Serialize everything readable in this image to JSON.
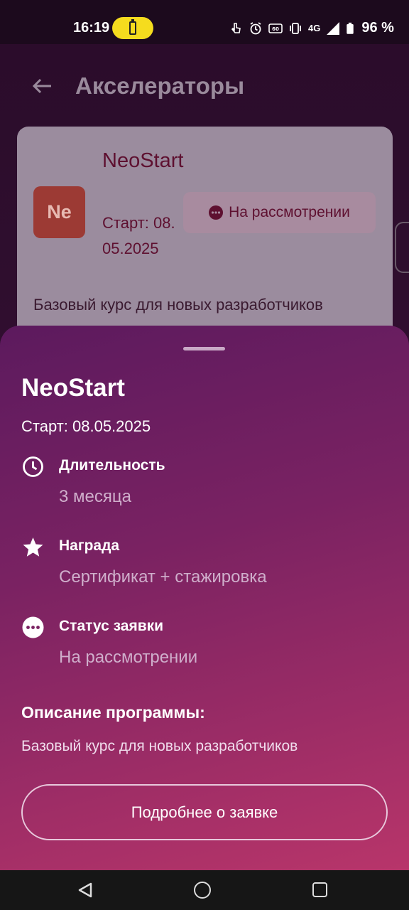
{
  "status_bar": {
    "time": "16:19",
    "battery_percent": "96 %",
    "network": "4G"
  },
  "app_bar": {
    "title": "Акселераторы"
  },
  "background_card": {
    "logo_text": "Ne",
    "name": "NeoStart",
    "start": "Старт: 08.05.2025",
    "status": "На рассмотрении",
    "description": "Базовый курс для новых разработчиков"
  },
  "sheet": {
    "title": "NeoStart",
    "start": "Старт: 08.05.2025",
    "details": [
      {
        "icon": "clock-icon",
        "label": "Длительность",
        "value": "3 месяца"
      },
      {
        "icon": "star-icon",
        "label": "Награда",
        "value": "Сертификат + стажировка"
      },
      {
        "icon": "more-dots-icon",
        "label": "Статус заявки",
        "value": "На рассмотрении"
      }
    ],
    "description_heading": "Описание программы:",
    "description": "Базовый курс для новых разработчиков",
    "button_label": "Подробнее о заявке"
  },
  "colors": {
    "sheet_gradient_start": "#5c1a5e",
    "sheet_gradient_end": "#b8356a",
    "card_text": "#5e1030",
    "battery_saver": "#f5dc1e"
  }
}
